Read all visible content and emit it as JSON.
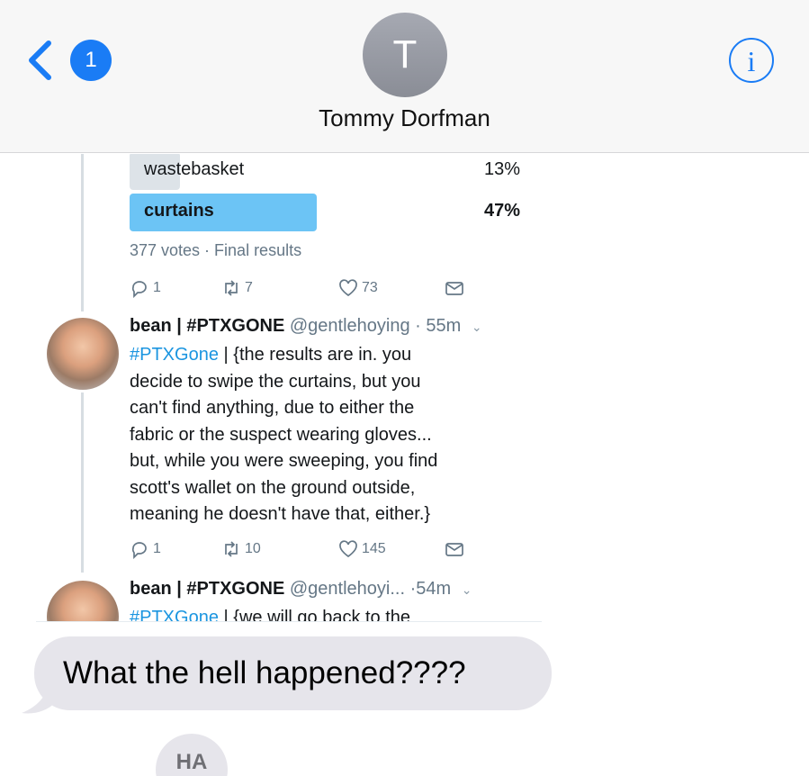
{
  "header": {
    "back_badge": "1",
    "avatar_initial": "T",
    "contact_name": "Tommy Dorfman",
    "info_symbol": "i"
  },
  "tweet_screenshot": {
    "poll": {
      "options": [
        {
          "label": "wastebasket",
          "percent": "13%",
          "share": 0.13,
          "winner": false
        },
        {
          "label": "curtains",
          "percent": "47%",
          "share": 0.47,
          "winner": true
        }
      ],
      "meta": "377 votes · Final results",
      "actions": {
        "replies": "1",
        "retweets": "7",
        "likes": "73"
      }
    },
    "tweets": [
      {
        "name": "bean | #PTXGONE",
        "handle": "@gentlehoying",
        "time": "· 55m",
        "hashtag": "#PTXGone",
        "text_lines": [
          " | {the results are in. you",
          "decide to swipe the curtains, but you",
          "can't find anything, due to either the",
          "fabric or the suspect wearing gloves...",
          "but, while you were sweeping, you find",
          "scott's wallet on the ground outside,",
          "meaning he doesn't have that, either.}"
        ],
        "actions": {
          "replies": "1",
          "retweets": "10",
          "likes": "145"
        }
      },
      {
        "name": "bean | #PTXGONE",
        "handle": "@gentlehoyi...",
        "time": "·54m",
        "hashtag": "#PTXGone",
        "text_lines": [
          " | {we will go back to the"
        ]
      }
    ]
  },
  "message": {
    "text": "What the hell happened????"
  },
  "typing_sticker": {
    "text": "HA"
  },
  "colors": {
    "accent": "#1a7cf5",
    "bubble": "#e6e5eb",
    "poll_winner": "#6cc4f5",
    "poll_other": "#dde3e8"
  }
}
